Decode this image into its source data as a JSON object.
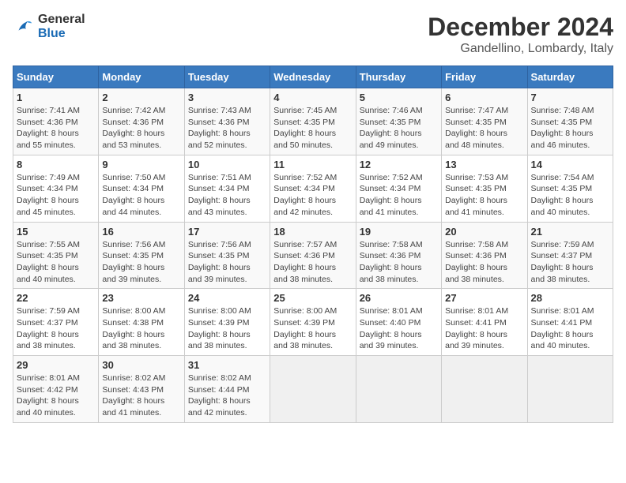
{
  "header": {
    "logo_line1": "General",
    "logo_line2": "Blue",
    "title": "December 2024",
    "subtitle": "Gandellino, Lombardy, Italy"
  },
  "weekdays": [
    "Sunday",
    "Monday",
    "Tuesday",
    "Wednesday",
    "Thursday",
    "Friday",
    "Saturday"
  ],
  "weeks": [
    [
      {
        "day": "1",
        "info": "Sunrise: 7:41 AM\nSunset: 4:36 PM\nDaylight: 8 hours\nand 55 minutes."
      },
      {
        "day": "2",
        "info": "Sunrise: 7:42 AM\nSunset: 4:36 PM\nDaylight: 8 hours\nand 53 minutes."
      },
      {
        "day": "3",
        "info": "Sunrise: 7:43 AM\nSunset: 4:36 PM\nDaylight: 8 hours\nand 52 minutes."
      },
      {
        "day": "4",
        "info": "Sunrise: 7:45 AM\nSunset: 4:35 PM\nDaylight: 8 hours\nand 50 minutes."
      },
      {
        "day": "5",
        "info": "Sunrise: 7:46 AM\nSunset: 4:35 PM\nDaylight: 8 hours\nand 49 minutes."
      },
      {
        "day": "6",
        "info": "Sunrise: 7:47 AM\nSunset: 4:35 PM\nDaylight: 8 hours\nand 48 minutes."
      },
      {
        "day": "7",
        "info": "Sunrise: 7:48 AM\nSunset: 4:35 PM\nDaylight: 8 hours\nand 46 minutes."
      }
    ],
    [
      {
        "day": "8",
        "info": "Sunrise: 7:49 AM\nSunset: 4:34 PM\nDaylight: 8 hours\nand 45 minutes."
      },
      {
        "day": "9",
        "info": "Sunrise: 7:50 AM\nSunset: 4:34 PM\nDaylight: 8 hours\nand 44 minutes."
      },
      {
        "day": "10",
        "info": "Sunrise: 7:51 AM\nSunset: 4:34 PM\nDaylight: 8 hours\nand 43 minutes."
      },
      {
        "day": "11",
        "info": "Sunrise: 7:52 AM\nSunset: 4:34 PM\nDaylight: 8 hours\nand 42 minutes."
      },
      {
        "day": "12",
        "info": "Sunrise: 7:52 AM\nSunset: 4:34 PM\nDaylight: 8 hours\nand 41 minutes."
      },
      {
        "day": "13",
        "info": "Sunrise: 7:53 AM\nSunset: 4:35 PM\nDaylight: 8 hours\nand 41 minutes."
      },
      {
        "day": "14",
        "info": "Sunrise: 7:54 AM\nSunset: 4:35 PM\nDaylight: 8 hours\nand 40 minutes."
      }
    ],
    [
      {
        "day": "15",
        "info": "Sunrise: 7:55 AM\nSunset: 4:35 PM\nDaylight: 8 hours\nand 40 minutes."
      },
      {
        "day": "16",
        "info": "Sunrise: 7:56 AM\nSunset: 4:35 PM\nDaylight: 8 hours\nand 39 minutes."
      },
      {
        "day": "17",
        "info": "Sunrise: 7:56 AM\nSunset: 4:35 PM\nDaylight: 8 hours\nand 39 minutes."
      },
      {
        "day": "18",
        "info": "Sunrise: 7:57 AM\nSunset: 4:36 PM\nDaylight: 8 hours\nand 38 minutes."
      },
      {
        "day": "19",
        "info": "Sunrise: 7:58 AM\nSunset: 4:36 PM\nDaylight: 8 hours\nand 38 minutes."
      },
      {
        "day": "20",
        "info": "Sunrise: 7:58 AM\nSunset: 4:36 PM\nDaylight: 8 hours\nand 38 minutes."
      },
      {
        "day": "21",
        "info": "Sunrise: 7:59 AM\nSunset: 4:37 PM\nDaylight: 8 hours\nand 38 minutes."
      }
    ],
    [
      {
        "day": "22",
        "info": "Sunrise: 7:59 AM\nSunset: 4:37 PM\nDaylight: 8 hours\nand 38 minutes."
      },
      {
        "day": "23",
        "info": "Sunrise: 8:00 AM\nSunset: 4:38 PM\nDaylight: 8 hours\nand 38 minutes."
      },
      {
        "day": "24",
        "info": "Sunrise: 8:00 AM\nSunset: 4:39 PM\nDaylight: 8 hours\nand 38 minutes."
      },
      {
        "day": "25",
        "info": "Sunrise: 8:00 AM\nSunset: 4:39 PM\nDaylight: 8 hours\nand 38 minutes."
      },
      {
        "day": "26",
        "info": "Sunrise: 8:01 AM\nSunset: 4:40 PM\nDaylight: 8 hours\nand 39 minutes."
      },
      {
        "day": "27",
        "info": "Sunrise: 8:01 AM\nSunset: 4:41 PM\nDaylight: 8 hours\nand 39 minutes."
      },
      {
        "day": "28",
        "info": "Sunrise: 8:01 AM\nSunset: 4:41 PM\nDaylight: 8 hours\nand 40 minutes."
      }
    ],
    [
      {
        "day": "29",
        "info": "Sunrise: 8:01 AM\nSunset: 4:42 PM\nDaylight: 8 hours\nand 40 minutes."
      },
      {
        "day": "30",
        "info": "Sunrise: 8:02 AM\nSunset: 4:43 PM\nDaylight: 8 hours\nand 41 minutes."
      },
      {
        "day": "31",
        "info": "Sunrise: 8:02 AM\nSunset: 4:44 PM\nDaylight: 8 hours\nand 42 minutes."
      },
      null,
      null,
      null,
      null
    ]
  ]
}
